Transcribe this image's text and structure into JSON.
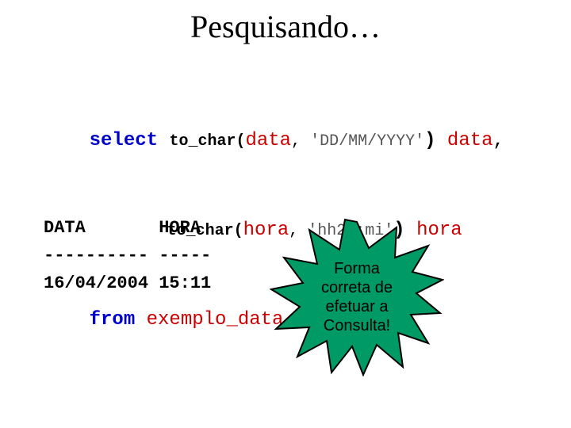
{
  "title": "Pesquisando…",
  "sql": {
    "select_kw": "select",
    "fn1": "to_char(",
    "arg1_ident": "data",
    "arg1_comma": ",",
    "arg1_literal": " 'DD/MM/YYYY'",
    "close1": ")",
    "alias1": " data",
    "outer_comma1": ",",
    "fn2": "to_char(",
    "arg2_ident": "hora",
    "arg2_comma": ",",
    "arg2_literal": " 'hh24:mi'",
    "close2": ")",
    "alias2": " hora",
    "from_kw": "from",
    "table": " exemplo_data_hora",
    "semicolon": ";"
  },
  "result": {
    "headers": "DATA       HORA",
    "divider": "---------- -----",
    "row1": "16/04/2004 15:11"
  },
  "callout": {
    "line1": "Forma",
    "line2": "correta de",
    "line3": "efetuar a",
    "line4": "Consulta!"
  },
  "colors": {
    "burst_fill": "#009a66",
    "burst_stroke": "#000000"
  }
}
